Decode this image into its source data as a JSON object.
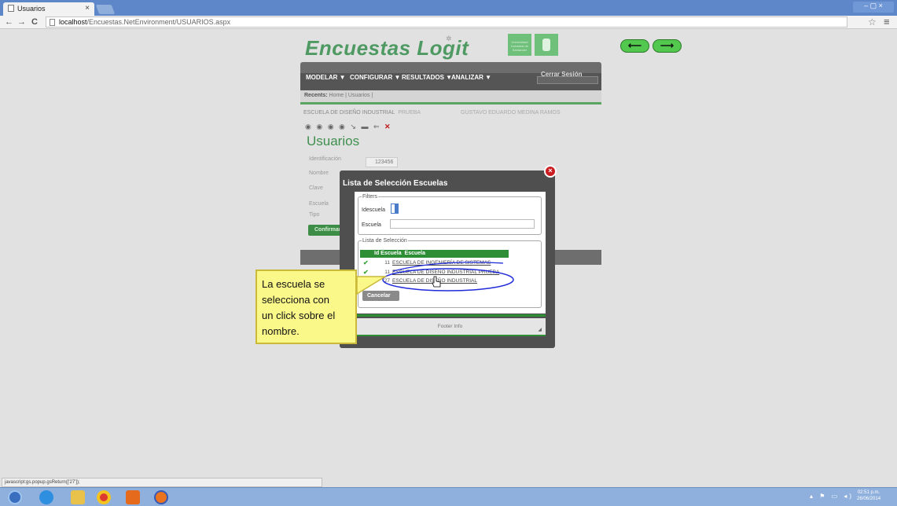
{
  "browser": {
    "tab_title": "Usuarios",
    "tab_close": "×",
    "window_controls": "– ▢ ×",
    "url_host": "localhost",
    "url_path": "/Encuestas.NetEnvironment/USUARIOS.aspx",
    "back": "←",
    "forward": "→",
    "reload": "C",
    "star": "☆",
    "menu": "≡"
  },
  "app": {
    "title": "Encuestas Logit",
    "logo_text": "Universidad Industrial de Santander",
    "nav_back": "⟵",
    "nav_forward": "⟶"
  },
  "menu": {
    "items": [
      "MODELAR ▼",
      "CONFIGURAR ▼",
      "RESULTADOS ▼",
      "ANALIZAR ▼"
    ],
    "logout": "Cerrar Sesión"
  },
  "recents": {
    "label": "Recents:",
    "links": "Home | Usuarios |"
  },
  "context": {
    "school": "ESCUELA DE DISEÑO INDUSTRIAL",
    "school_suffix": "PRUEBA",
    "user": "GUSTAVO EDUARDO MEDINA RAMOS"
  },
  "toolbar": {
    "icons": "◉ ◉ ◉ ◉ ↘ ▬ ⇐",
    "delete": "✕"
  },
  "form": {
    "title": "Usuarios",
    "labels": [
      "Identificación",
      "Nombre",
      "Clave",
      "Escuela",
      "Tipo"
    ],
    "identificacion_value": "123456",
    "confirm_label": "Confirmar"
  },
  "modal": {
    "title": "Lista de Selección Escuelas",
    "close": "×",
    "filters_legend": "Filters",
    "idescuela_label": "Idescuela",
    "escuela_label": "Escuela",
    "lista_legend": "Lista de Selección",
    "col_id": "Id Escuela",
    "col_name": "Escuela",
    "rows": [
      {
        "check": "✔",
        "id": "11",
        "name": "ESCUELA DE INGENIERÍA DE SISTEMAS"
      },
      {
        "check": "✔",
        "id": "11",
        "name": "ESCUELA DE DISEÑO INDUSTRIAL PRUEBA"
      },
      {
        "check": "",
        "id": "27",
        "name": "ESCUELA DE DISEÑO INDUSTRIAL"
      }
    ],
    "cancel_label": "Cancelar",
    "footer": "Footer Info",
    "grip": "◢"
  },
  "annotation": {
    "lines": [
      "La escuela se",
      "selecciona con",
      "un click sobre el",
      "nombre."
    ]
  },
  "status": {
    "text": "javascript:gs.popup.gsReturn(['27']);"
  },
  "taskbar": {
    "time": "02:51 p.m.",
    "date": "26/06/2014",
    "tray": "▴ ⚑ ▭ ◂)"
  },
  "colors": {
    "accent_green": "#4e9a62",
    "table_green": "#2e8e36",
    "close_red": "#c81e22",
    "callout_yellow": "#fbf88a",
    "ellipse_blue": "#1f2bd9"
  }
}
